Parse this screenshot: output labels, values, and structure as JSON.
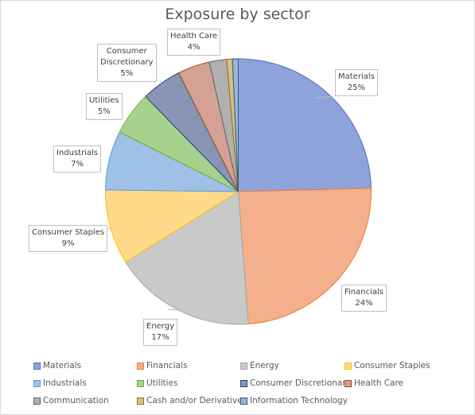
{
  "chart_data": {
    "type": "pie",
    "title": "Exposure by sector",
    "legend_position": "bottom",
    "slices": [
      {
        "label": "Materials",
        "value": 24.6,
        "display": "25%",
        "color": "#8ea3d9",
        "edge": "#4472c4"
      },
      {
        "label": "Financials",
        "value": 24.2,
        "display": "24%",
        "color": "#f4b08d",
        "edge": "#ed7d31"
      },
      {
        "label": "Energy",
        "value": 17.3,
        "display": "17%",
        "color": "#c9c9c9",
        "edge": "#a5a5a5"
      },
      {
        "label": "Consumer Staples",
        "value": 9.1,
        "display": "9%",
        "color": "#ffd98a",
        "edge": "#ffc000"
      },
      {
        "label": "Industrials",
        "value": 7.2,
        "display": "7%",
        "color": "#9fc1e8",
        "edge": "#5b9bd5"
      },
      {
        "label": "Utilities",
        "value": 5.3,
        "display": "5%",
        "color": "#a9d18e",
        "edge": "#70ad47"
      },
      {
        "label": "Consumer Discretionary",
        "value": 4.9,
        "display": "5%",
        "color": "#8a95b5",
        "edge": "#264478"
      },
      {
        "label": "Health Care",
        "value": 3.9,
        "display": "4%",
        "color": "#d4a195",
        "edge": "#9e480e"
      },
      {
        "label": "Communication",
        "value": 2.1,
        "display": "",
        "color": "#b0b0b0",
        "edge": "#636363"
      },
      {
        "label": "Cash and/or Derivatives",
        "value": 0.7,
        "display": "",
        "color": "#d6bf8c",
        "edge": "#997300"
      },
      {
        "label": "Information Technology",
        "value": 0.7,
        "display": "",
        "color": "#9fb3d6",
        "edge": "#255e91"
      }
    ]
  }
}
